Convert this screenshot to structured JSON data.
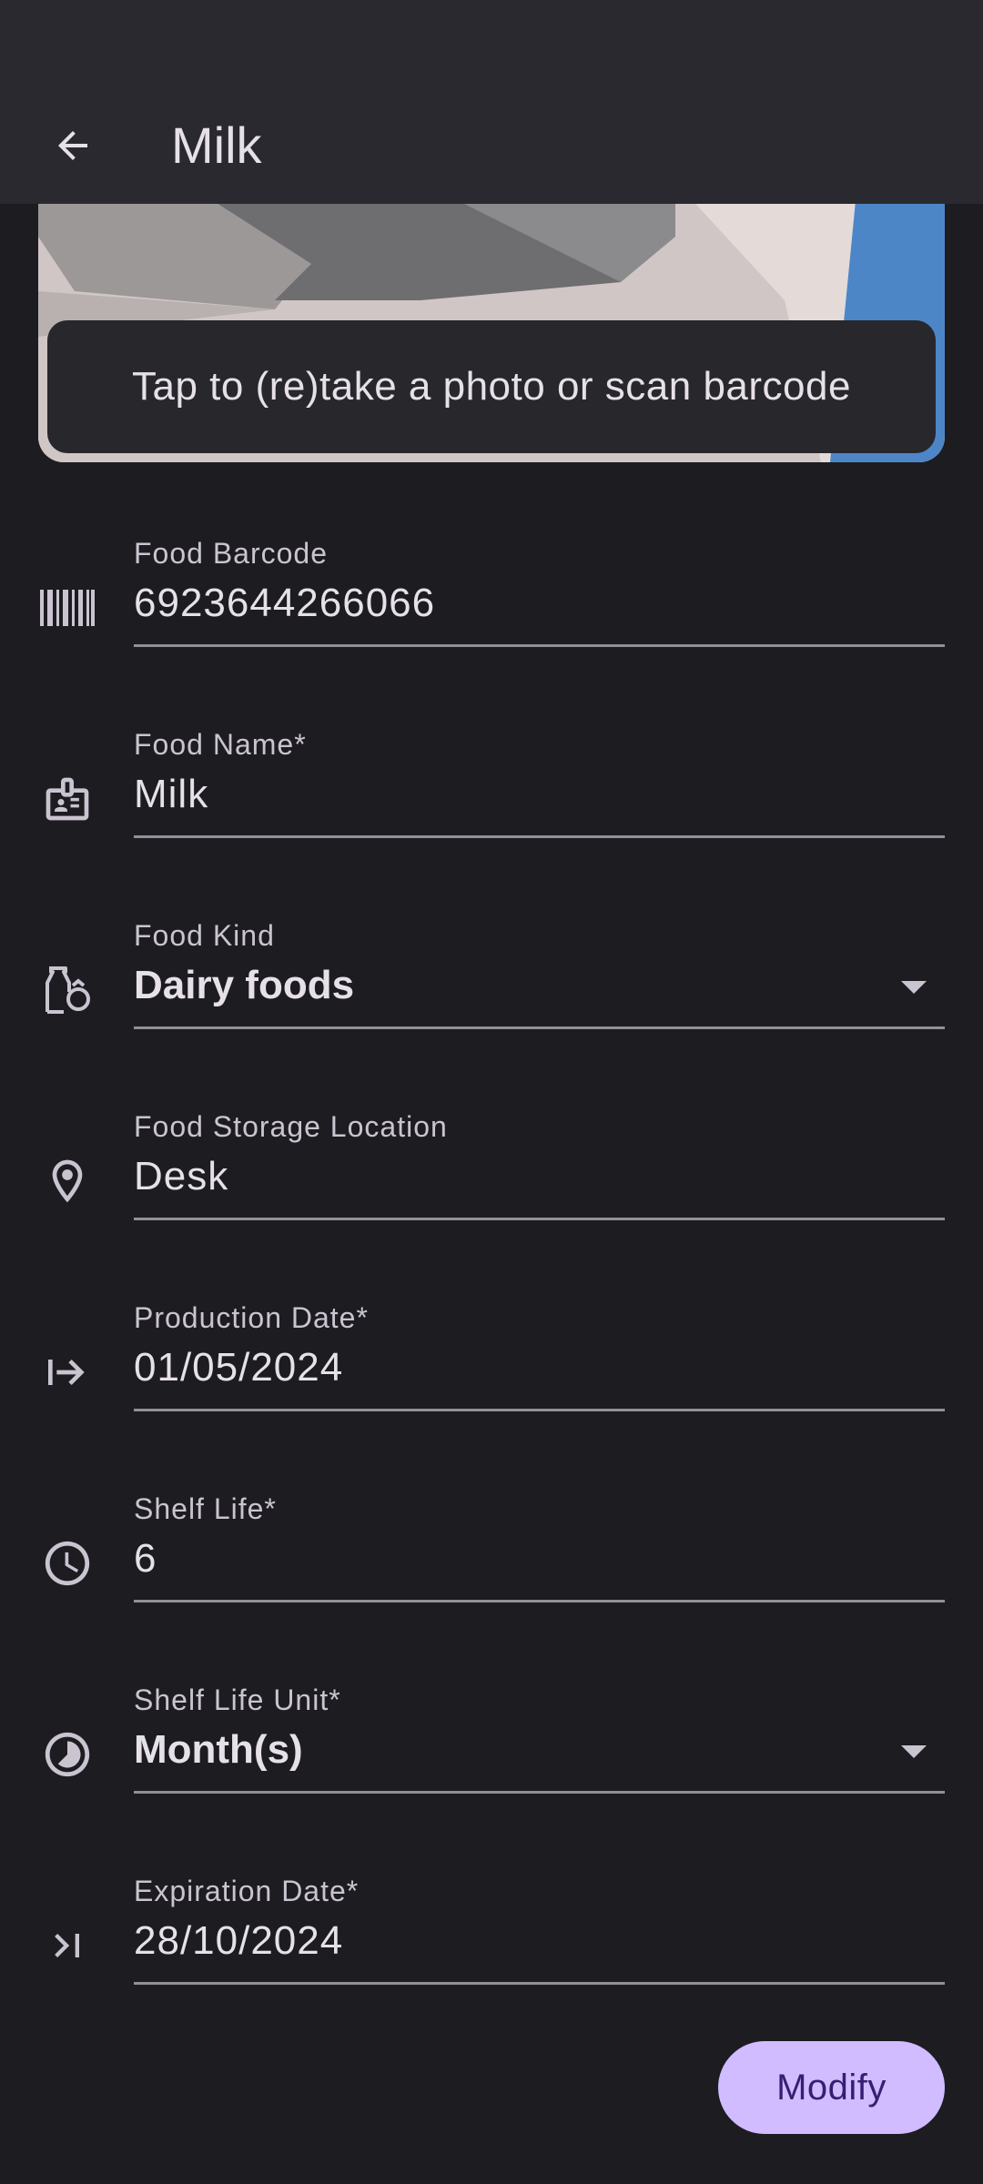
{
  "app_bar": {
    "title": "Milk"
  },
  "photo": {
    "button_label": "Tap to (re)take a photo or scan barcode"
  },
  "fields": [
    {
      "label": "Food Barcode",
      "value": "6923644266066",
      "icon": "barcode-icon"
    },
    {
      "label": "Food Name*",
      "value": "Milk",
      "icon": "badge-icon"
    },
    {
      "label": "Food Kind",
      "value": "Dairy foods",
      "icon": "food-kind-icon"
    },
    {
      "label": "Food Storage Location",
      "value": "Desk",
      "icon": "location-pin-icon"
    },
    {
      "label": "Production Date*",
      "value": "01/05/2024",
      "icon": "arrow-right-to-line-icon"
    },
    {
      "label": "Shelf Life*",
      "value": "6",
      "icon": "clock-icon"
    },
    {
      "label": "Shelf Life Unit*",
      "value": "Month(s)",
      "icon": "timelapse-icon"
    },
    {
      "label": "Expiration Date*",
      "value": "28/10/2024",
      "icon": "last-page-icon"
    }
  ],
  "actions": {
    "modify_label": "Modify"
  },
  "colors": {
    "background": "#1d1c21",
    "app_bar": "#2b2930",
    "primary_container": "#d0bcff",
    "on_primary": "#381e72"
  }
}
